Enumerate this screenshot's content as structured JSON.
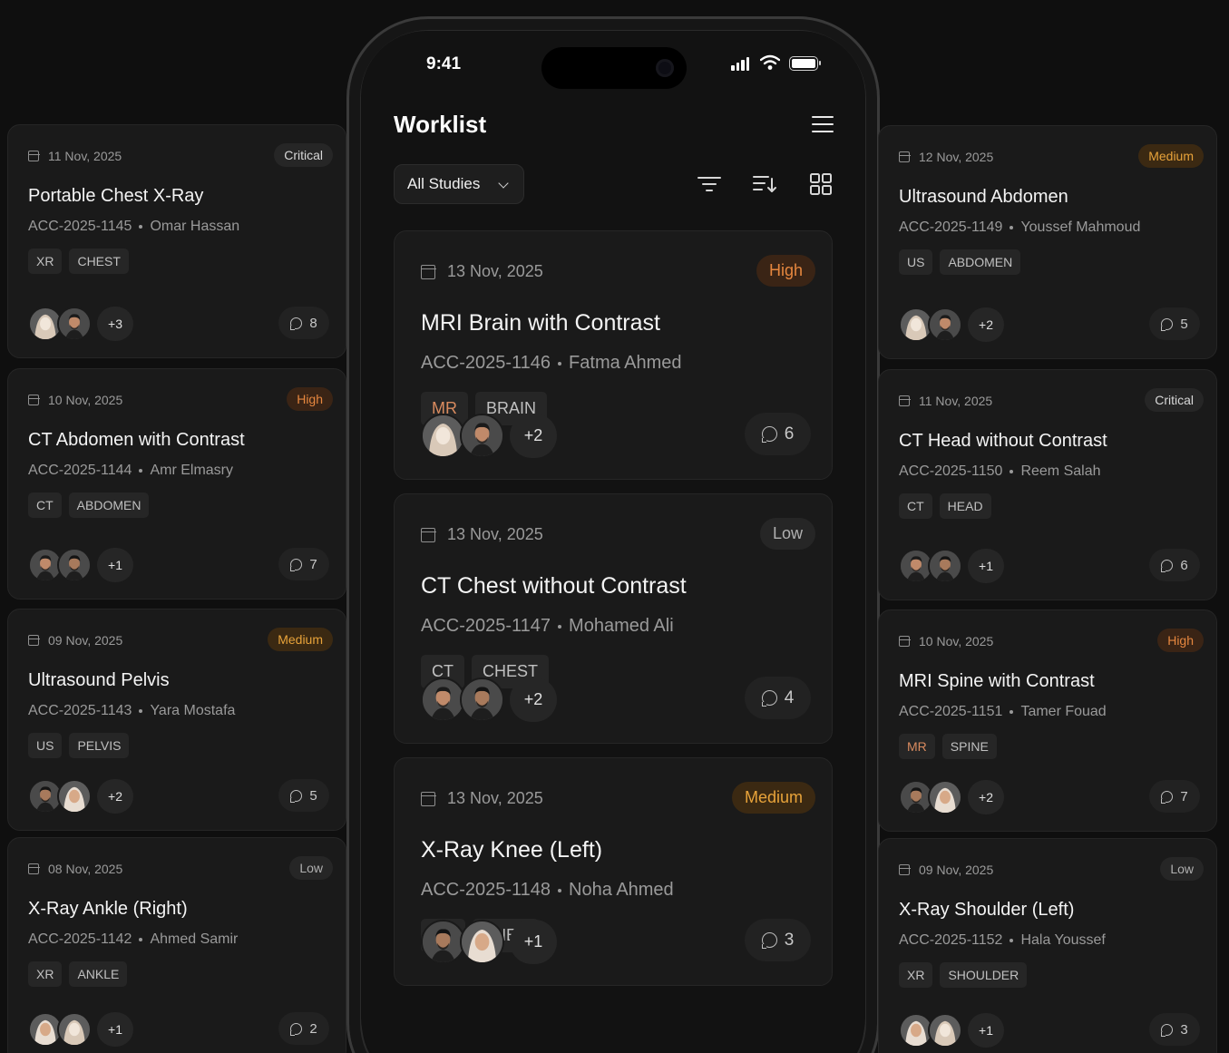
{
  "status_bar": {
    "time": "9:41"
  },
  "header": {
    "title": "Worklist",
    "menu_icon": "hamburger-menu-icon"
  },
  "toolbar": {
    "filter_select": "All Studies",
    "icons": [
      "filter-icon",
      "sort-icon",
      "grid-view-icon"
    ]
  },
  "colors": {
    "background": "#0f0f0f",
    "card": "#1a1a1a",
    "high": "#e6873f",
    "medium": "#e8a33a",
    "mr_tag": "#d98b5f"
  },
  "phone_studies": [
    {
      "date": "13 Nov, 2025",
      "priority": "High",
      "title": "MRI Brain with Contrast",
      "accession": "ACC-2025-1146",
      "patient": "Fatma Ahmed",
      "tags": [
        "MR",
        "BRAIN"
      ],
      "more": "+2",
      "comments": "6"
    },
    {
      "date": "13 Nov, 2025",
      "priority": "Low",
      "title": "CT Chest without Contrast",
      "accession": "ACC-2025-1147",
      "patient": "Mohamed Ali",
      "tags": [
        "CT",
        "CHEST"
      ],
      "more": "+2",
      "comments": "4"
    },
    {
      "date": "13 Nov, 2025",
      "priority": "Medium",
      "title": "X-Ray Knee (Left)",
      "accession": "ACC-2025-1148",
      "patient": "Noha Ahmed",
      "tags": [
        "XR",
        "KNEE"
      ],
      "more": "+1",
      "comments": "3"
    }
  ],
  "left_studies": [
    {
      "date": "11 Nov, 2025",
      "priority": "Critical",
      "title": "Portable Chest X-Ray",
      "accession": "ACC-2025-1145",
      "patient": "Omar Hassan",
      "tags": [
        "XR",
        "CHEST"
      ],
      "more": "+3",
      "comments": "8"
    },
    {
      "date": "10 Nov, 2025",
      "priority": "High",
      "title": "CT Abdomen with Contrast",
      "accession": "ACC-2025-1144",
      "patient": "Amr Elmasry",
      "tags": [
        "CT",
        "ABDOMEN"
      ],
      "more": "+1",
      "comments": "7"
    },
    {
      "date": "09 Nov, 2025",
      "priority": "Medium",
      "title": "Ultrasound Pelvis",
      "accession": "ACC-2025-1143",
      "patient": "Yara Mostafa",
      "tags": [
        "US",
        "PELVIS"
      ],
      "more": "+2",
      "comments": "5"
    },
    {
      "date": "08 Nov, 2025",
      "priority": "Low",
      "title": "X-Ray Ankle (Right)",
      "accession": "ACC-2025-1142",
      "patient": "Ahmed Samir",
      "tags": [
        "XR",
        "ANKLE"
      ],
      "more": "+1",
      "comments": "2"
    }
  ],
  "right_studies": [
    {
      "date": "12 Nov, 2025",
      "priority": "Medium",
      "title": "Ultrasound Abdomen",
      "accession": "ACC-2025-1149",
      "patient": "Youssef Mahmoud",
      "tags": [
        "US",
        "ABDOMEN"
      ],
      "more": "+2",
      "comments": "5"
    },
    {
      "date": "11 Nov, 2025",
      "priority": "Critical",
      "title": "CT Head without Contrast",
      "accession": "ACC-2025-1150",
      "patient": "Reem Salah",
      "tags": [
        "CT",
        "HEAD"
      ],
      "more": "+1",
      "comments": "6"
    },
    {
      "date": "10 Nov, 2025",
      "priority": "High",
      "title": "MRI Spine with Contrast",
      "accession": "ACC-2025-1151",
      "patient": "Tamer Fouad",
      "tags": [
        "MR",
        "SPINE"
      ],
      "more": "+2",
      "comments": "7"
    },
    {
      "date": "09 Nov, 2025",
      "priority": "Low",
      "title": "X-Ray Shoulder (Left)",
      "accession": "ACC-2025-1152",
      "patient": "Hala Youssef",
      "tags": [
        "XR",
        "SHOULDER"
      ],
      "more": "+1",
      "comments": "3"
    }
  ]
}
